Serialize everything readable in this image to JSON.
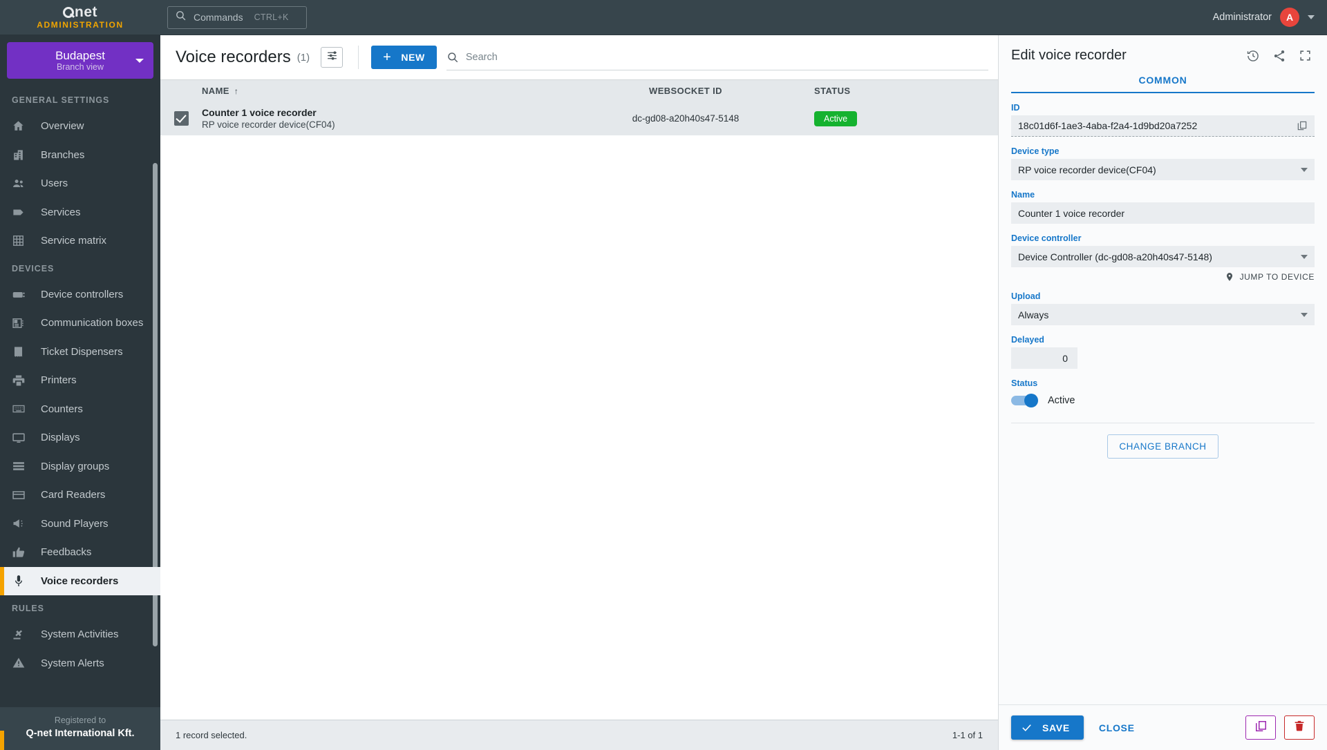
{
  "brand": {
    "logo": "Q-net",
    "subtitle": "ADMINISTRATION"
  },
  "branch": {
    "name": "Budapest",
    "subtitle": "Branch view",
    "caret_icon": "chevron-down-icon"
  },
  "sidebar": {
    "sections": [
      {
        "label": "GENERAL SETTINGS",
        "items": [
          {
            "label": "Overview",
            "icon": "home-icon"
          },
          {
            "label": "Branches",
            "icon": "building-icon"
          },
          {
            "label": "Users",
            "icon": "users-icon"
          },
          {
            "label": "Services",
            "icon": "tag-icon"
          },
          {
            "label": "Service matrix",
            "icon": "grid-icon"
          }
        ]
      },
      {
        "label": "DEVICES",
        "items": [
          {
            "label": "Device controllers",
            "icon": "device-controller-icon"
          },
          {
            "label": "Communication boxes",
            "icon": "comm-box-icon"
          },
          {
            "label": "Ticket Dispensers",
            "icon": "ticket-dispenser-icon"
          },
          {
            "label": "Printers",
            "icon": "printer-icon"
          },
          {
            "label": "Counters",
            "icon": "keyboard-icon"
          },
          {
            "label": "Displays",
            "icon": "monitor-icon"
          },
          {
            "label": "Display groups",
            "icon": "stack-icon"
          },
          {
            "label": "Card Readers",
            "icon": "card-reader-icon"
          },
          {
            "label": "Sound Players",
            "icon": "speaker-icon"
          },
          {
            "label": "Feedbacks",
            "icon": "thumbs-up-icon"
          },
          {
            "label": "Voice recorders",
            "icon": "microphone-icon",
            "active": true
          }
        ]
      },
      {
        "label": "RULES",
        "items": [
          {
            "label": "System Activities",
            "icon": "gavel-icon"
          },
          {
            "label": "System Alerts",
            "icon": "warning-triangle-icon"
          }
        ]
      }
    ],
    "registered": {
      "top": "Registered to",
      "bottom": "Q-net International Kft."
    }
  },
  "topbar": {
    "commands_label": "Commands",
    "commands_shortcut": "CTRL+K",
    "search_icon": "search-icon",
    "user_name": "Administrator",
    "avatar_initial": "A",
    "caret_icon": "chevron-down-icon"
  },
  "main": {
    "title": "Voice recorders",
    "count": "(1)",
    "filter_icon": "filter-settings-icon",
    "new_button": "NEW",
    "search_placeholder": "Search",
    "search_value": "",
    "columns": [
      "NAME",
      "WEBSOCKET ID",
      "STATUS"
    ],
    "sort_arrow": "↑",
    "rows": [
      {
        "selected": true,
        "name": "Counter 1 voice recorder",
        "subtitle": "RP voice recorder device(CF04)",
        "websocket_id": "dc-gd08-a20h40s47-5148",
        "status": "Active"
      }
    ],
    "footer_left": "1 record selected.",
    "footer_right": "1-1 of 1"
  },
  "panel": {
    "title": "Edit voice recorder",
    "header_icons": [
      "history-icon",
      "share-icon",
      "fullscreen-icon"
    ],
    "tab": "COMMON",
    "fields": {
      "id_label": "ID",
      "id_value": "18c01d6f-1ae3-4aba-f2a4-1d9bd20a7252",
      "copy_icon": "copy-icon",
      "device_type_label": "Device type",
      "device_type_value": "RP voice recorder device(CF04)",
      "name_label": "Name",
      "name_value": "Counter 1 voice recorder",
      "device_controller_label": "Device controller",
      "device_controller_value": "Device Controller (dc-gd08-a20h40s47-5148)",
      "jump_to_device": "JUMP TO DEVICE",
      "jump_icon": "map-pin-icon",
      "upload_label": "Upload",
      "upload_value": "Always",
      "delayed_label": "Delayed",
      "delayed_value": "0",
      "status_label": "Status",
      "status_toggle_value": "Active",
      "status_toggle_on": true
    },
    "change_branch_button": "CHANGE BRANCH",
    "save_button": "SAVE",
    "save_icon": "check-icon",
    "close_button": "CLOSE",
    "duplicate_icon": "copy-icon",
    "delete_icon": "trash-icon"
  },
  "colors": {
    "sidebar_bg": "#2b363c",
    "sidebar_header_bg": "#37454c",
    "brand_accent": "#f0a500",
    "branch_purple": "#7230c4",
    "active_item_accent": "#f5a300",
    "primary_blue": "#1677c9",
    "status_green": "#15b22f",
    "avatar_red": "#e8453c",
    "delete_red": "#c62828",
    "duplicate_purple": "#9c27b0"
  }
}
